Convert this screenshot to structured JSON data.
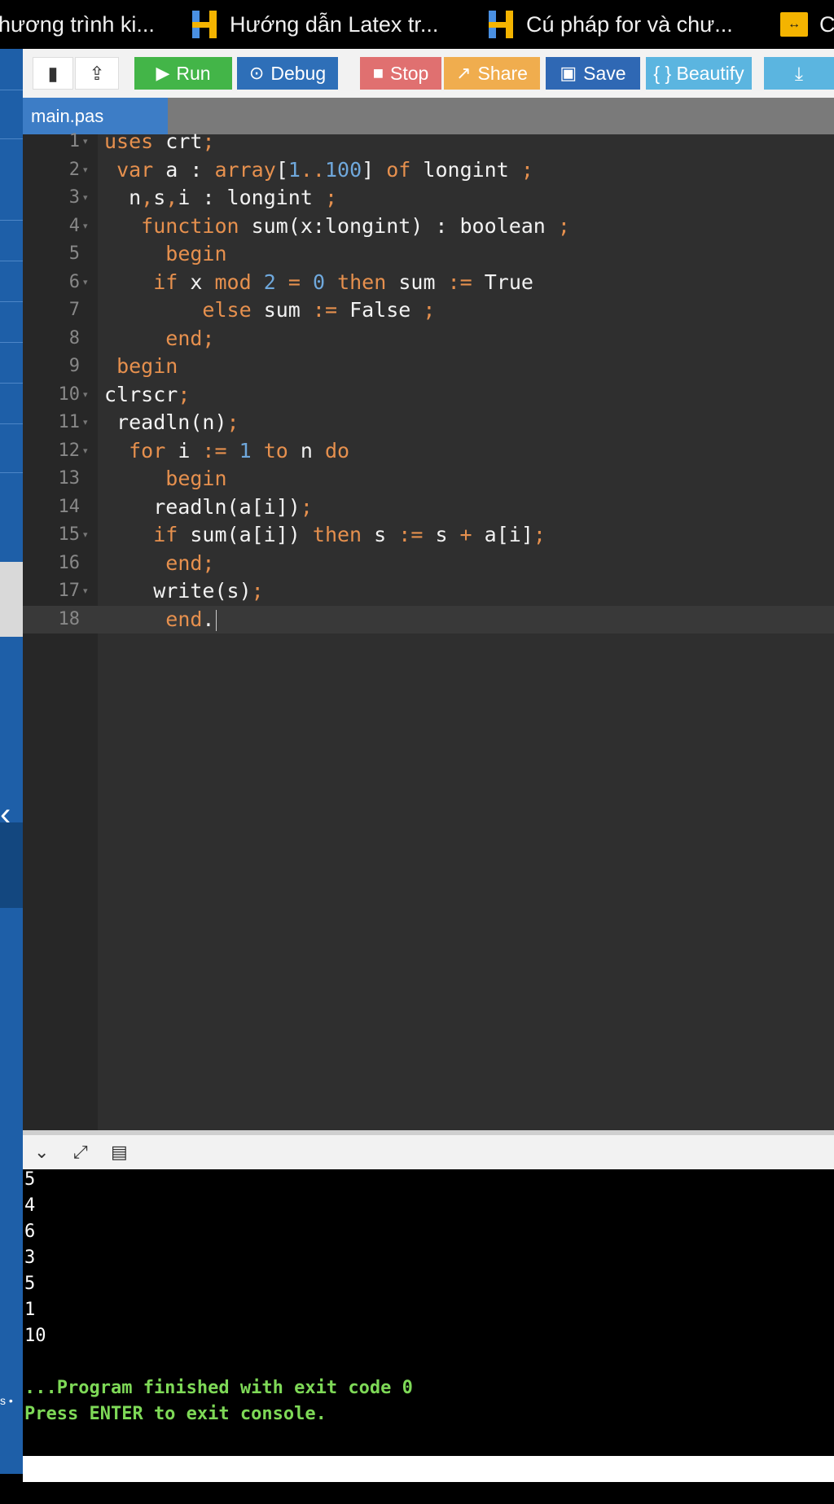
{
  "bookmarks": [
    {
      "label": "hương trình ki...",
      "icon": "none"
    },
    {
      "label": "Hướng dẫn Latex tr...",
      "icon": "h-logo-icon"
    },
    {
      "label": "Cú pháp for và chư...",
      "icon": "h-logo-icon"
    },
    {
      "label": "C",
      "icon": "arrows-icon"
    }
  ],
  "toolbar": {
    "run": "Run",
    "debug": "Debug",
    "stop": "Stop",
    "share": "Share",
    "save": "Save",
    "beautify": "{ } Beautify"
  },
  "file_tab": "main.pas",
  "editor": {
    "active_line": 18,
    "line_numbers": [
      "1",
      "2",
      "3",
      "4",
      "5",
      "6",
      "7",
      "8",
      "9",
      "10",
      "11",
      "12",
      "13",
      "14",
      "15",
      "16",
      "17",
      "18"
    ],
    "lines": [
      "uses crt;",
      " var a : array[1..100] of longint ;",
      "  n,s,i : longint ;",
      "   function sum(x:longint) : boolean ;",
      "     begin",
      "    if x mod 2 = 0 then sum := True",
      "        else sum := False ;",
      "     end;",
      " begin",
      "clrscr;",
      " readln(n);",
      "  for i := 1 to n do",
      "     begin",
      "    readln(a[i]);",
      "    if sum(a[i]) then s := s + a[i];",
      "     end;",
      "    write(s);",
      "     end."
    ]
  },
  "console": {
    "output": [
      "5",
      "4",
      "6",
      "3",
      "5",
      "1",
      "10"
    ],
    "finished": "...Program finished with exit code 0",
    "press_enter": "Press ENTER to exit console."
  },
  "colors": {
    "run": "#43b548",
    "debug": "#2e6fb8",
    "stop": "#e07070",
    "share": "#f0ad4e",
    "save": "#2f68b4",
    "beautify": "#5bb5e0",
    "keyword": "#e6904e",
    "number": "#6fa8dc",
    "console_green": "#7ed957"
  }
}
